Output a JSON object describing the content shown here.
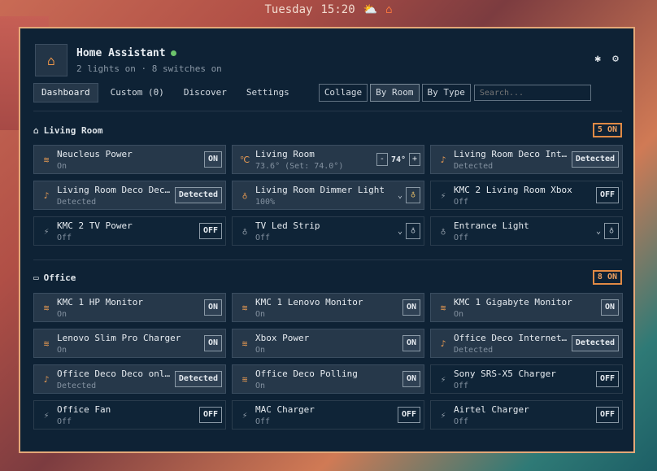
{
  "topbar": {
    "day": "Tuesday",
    "time": "15:20"
  },
  "header": {
    "title": "Home Assistant",
    "subtitle": "2 lights on · 8 switches on"
  },
  "nav": {
    "tabs": [
      "Dashboard",
      "Custom (0)",
      "Discover",
      "Settings"
    ],
    "views": [
      "Collage",
      "By Room",
      "By Type"
    ],
    "search_placeholder": "Search..."
  },
  "sections": [
    {
      "title": "Living Room",
      "count": "5 ON",
      "cards": [
        {
          "name": "Neucleus Power",
          "state": "On",
          "control": "ON",
          "icon": "wifi-icon",
          "on": true
        },
        {
          "name": "Living Room",
          "state": "73.6° (Set: 74.0°)",
          "control": "74°",
          "icon": "thermostat-icon",
          "on": true,
          "type": "climate"
        },
        {
          "name": "Living Room Deco Internet online",
          "state": "Detected",
          "control": "Detected",
          "icon": "bell-icon",
          "on": true
        },
        {
          "name": "Living Room Deco Deco online",
          "state": "Detected",
          "control": "Detected",
          "icon": "bell-icon",
          "on": true
        },
        {
          "name": "Living Room Dimmer Light",
          "state": "100%",
          "icon": "bulb-icon",
          "on": true,
          "type": "light"
        },
        {
          "name": "KMC 2 Living Room Xbox",
          "state": "Off",
          "control": "OFF",
          "icon": "plug-icon",
          "on": false
        },
        {
          "name": "KMC 2 TV Power",
          "state": "Off",
          "control": "OFF",
          "icon": "plug-icon",
          "on": false
        },
        {
          "name": "TV Led Strip",
          "state": "Off",
          "icon": "bulb-icon",
          "on": false,
          "type": "light"
        },
        {
          "name": "Entrance Light",
          "state": "Off",
          "icon": "bulb-icon",
          "on": false,
          "type": "light"
        }
      ]
    },
    {
      "title": "Office",
      "count": "8 ON",
      "cards": [
        {
          "name": "KMC 1 HP Monitor",
          "state": "On",
          "control": "ON",
          "icon": "wifi-icon",
          "on": true
        },
        {
          "name": "KMC 1 Lenovo Monitor",
          "state": "On",
          "control": "ON",
          "icon": "wifi-icon",
          "on": true
        },
        {
          "name": "KMC 1 Gigabyte Monitor",
          "state": "On",
          "control": "ON",
          "icon": "wifi-icon",
          "on": true
        },
        {
          "name": "Lenovo Slim Pro Charger",
          "state": "On",
          "control": "ON",
          "icon": "wifi-icon",
          "on": true
        },
        {
          "name": "Xbox Power",
          "state": "On",
          "control": "ON",
          "icon": "wifi-icon",
          "on": true
        },
        {
          "name": "Office Deco Internet online",
          "state": "Detected",
          "control": "Detected",
          "icon": "bell-icon",
          "on": true
        },
        {
          "name": "Office Deco Deco online",
          "state": "Detected",
          "control": "Detected",
          "icon": "bell-icon",
          "on": true
        },
        {
          "name": "Office Deco Polling",
          "state": "On",
          "control": "ON",
          "icon": "wifi-icon",
          "on": true
        },
        {
          "name": "Sony SRS-X5 Charger",
          "state": "Off",
          "control": "OFF",
          "icon": "plug-icon",
          "on": false
        },
        {
          "name": "Office Fan",
          "state": "Off",
          "control": "OFF",
          "icon": "plug-icon",
          "on": false
        },
        {
          "name": "MAC Charger",
          "state": "Off",
          "control": "OFF",
          "icon": "plug-icon",
          "on": false
        },
        {
          "name": "Airtel Charger",
          "state": "Off",
          "control": "OFF",
          "icon": "plug-icon",
          "on": false
        }
      ]
    }
  ],
  "colors": {
    "accent": "#e89a52",
    "border": "#e5a878",
    "panel": "#0e2235",
    "on_card": "#26384a"
  }
}
